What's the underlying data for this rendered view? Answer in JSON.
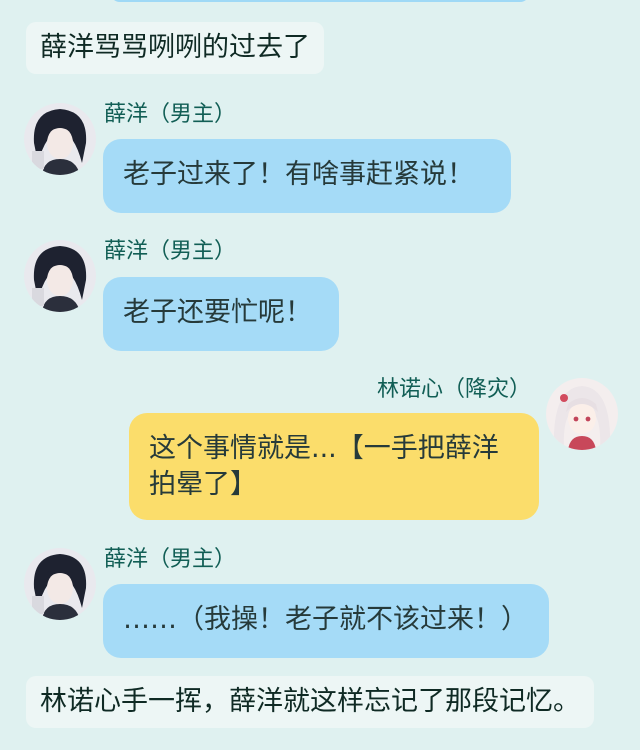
{
  "narration_top": "薛洋骂骂咧咧的过去了",
  "narration_bottom": "林诺心手一挥，薛洋就这样忘记了那段记忆。",
  "messages": [
    {
      "speaker": "薛洋（男主）",
      "avatar": "male-lead-avatar",
      "side": "left",
      "text": "老子过来了！有啥事赶紧说！",
      "bubble_color": "#a5dbf7"
    },
    {
      "speaker": "薛洋（男主）",
      "avatar": "male-lead-avatar",
      "side": "left",
      "text": "老子还要忙呢！",
      "bubble_color": "#a5dbf7"
    },
    {
      "speaker": "林诺心（降灾）",
      "avatar": "female-lead-avatar",
      "side": "right",
      "text": "这个事情就是...【一手把薛洋拍晕了】",
      "bubble_color": "#fbdd6b"
    },
    {
      "speaker": "薛洋（男主）",
      "avatar": "male-lead-avatar",
      "side": "left",
      "text": "……（我操！老子就不该过来！）",
      "bubble_color": "#a5dbf7"
    }
  ],
  "colors": {
    "background": "#dff1f0",
    "name_text": "#115e55",
    "narration_bg": "#edf6f5"
  }
}
